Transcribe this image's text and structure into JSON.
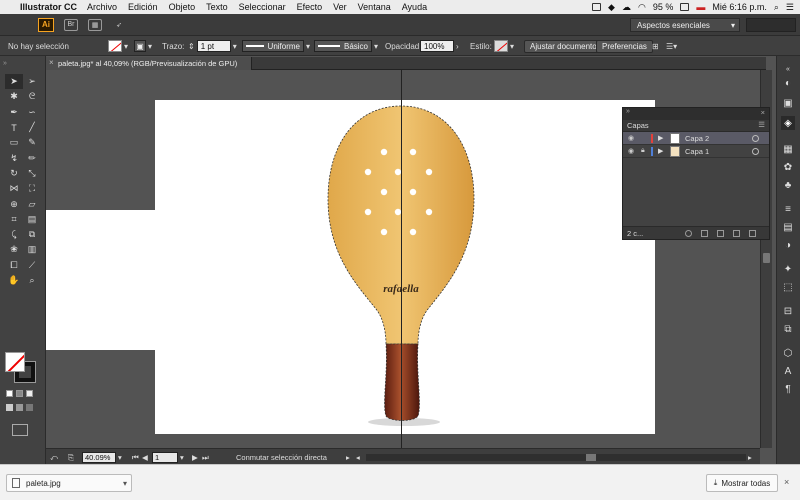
{
  "menubar": {
    "app_name": "Illustrator CC",
    "menus": [
      "Archivo",
      "Edición",
      "Objeto",
      "Texto",
      "Seleccionar",
      "Efecto",
      "Ver",
      "Ventana",
      "Ayuda"
    ],
    "battery": "95 %",
    "clock": "Mié 6:16 p.m."
  },
  "appbar": {
    "logo": "Ai",
    "workspace": "Aspectos esenciales"
  },
  "control": {
    "selection_status": "No hay selección",
    "stroke_label": "Trazo:",
    "stroke_weight": "1 pt",
    "profile": "Uniforme",
    "brush": "Básico",
    "opacity_label": "Opacidad:",
    "opacity_value": "100%",
    "style_label": "Estilo:",
    "document_setup": "Ajustar documento",
    "preferences": "Preferencias"
  },
  "document": {
    "tab_title": "paleta.jpg* al 40,09% (RGB/Previsualización de GPU)",
    "brand_text": "rafaella"
  },
  "layers_panel": {
    "title": "Capas",
    "layers": [
      {
        "name": "Capa 2",
        "color": "#e4403a",
        "selected": true
      },
      {
        "name": "Capa 1",
        "color": "#4f7fd8",
        "selected": false
      }
    ],
    "count": "2 c..."
  },
  "status": {
    "zoom": "40.09%",
    "artboard": "1",
    "tool_status": "Conmutar selección directa"
  },
  "downloads": {
    "file": "paleta.jpg",
    "show_all": "Mostrar todas"
  },
  "icons": {
    "tools": [
      "selection-tool-icon",
      "direct-selection-tool-icon",
      "magic-wand-icon",
      "lasso-icon",
      "pen-tool-icon",
      "curvature-icon",
      "type-tool-icon",
      "line-tool-icon",
      "rectangle-tool-icon",
      "paintbrush-icon",
      "shaper-icon",
      "pencil-icon",
      "rotate-icon",
      "scale-icon",
      "width-tool-icon",
      "free-transform-icon",
      "shape-builder-icon",
      "perspective-icon",
      "mesh-icon",
      "gradient-icon",
      "eyedropper-icon",
      "blend-icon",
      "symbol-sprayer-icon",
      "graph-icon",
      "artboard-icon",
      "slice-icon",
      "hand-icon",
      "zoom-icon"
    ]
  }
}
